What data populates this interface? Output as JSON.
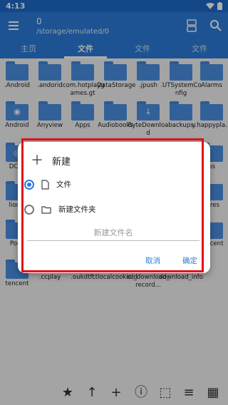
{
  "statusbar": {
    "time": "4:13"
  },
  "appbar": {
    "count": "0",
    "path": "/storage/emulated/0"
  },
  "tabs": [
    {
      "label": "主页"
    },
    {
      "label": "文件"
    },
    {
      "label": "文件"
    },
    {
      "label": "文件"
    }
  ],
  "files": [
    {
      "label": ".Android"
    },
    {
      "label": ".andorid"
    },
    {
      "label": ".com.hotplaygames.gt"
    },
    {
      "label": ".DataStorage"
    },
    {
      "label": ".jpush"
    },
    {
      "label": ".UTSystemConfig"
    },
    {
      "label": "Alarms"
    },
    {
      "label": "Android"
    },
    {
      "label": "Anyview"
    },
    {
      "label": "Apps"
    },
    {
      "label": "Audiobooks"
    },
    {
      "label": "ByteDownload"
    },
    {
      "label": "backups"
    },
    {
      "label": "y.happypla..."
    },
    {
      "label": "DCIM"
    },
    {
      "label": "bs"
    },
    {
      "label": "lionM"
    },
    {
      "label": "tures"
    },
    {
      "label": "Podc"
    },
    {
      "label": "tencent"
    },
    {
      "label": "tencent"
    },
    {
      "label": ".ccplay"
    },
    {
      "label": ".oukdtft"
    },
    {
      "label": ".tlocalcookieid"
    },
    {
      "label": "cc_download_record..."
    },
    {
      "label": "download_info"
    }
  ],
  "dialog": {
    "title": "新建",
    "option_file": "文件",
    "option_folder": "新建文件夹",
    "input_placeholder": "新建文件名",
    "cancel": "取消",
    "confirm": "确定"
  },
  "colors": {
    "primary": "#2b7bd8",
    "highlight": "#e20d18"
  }
}
